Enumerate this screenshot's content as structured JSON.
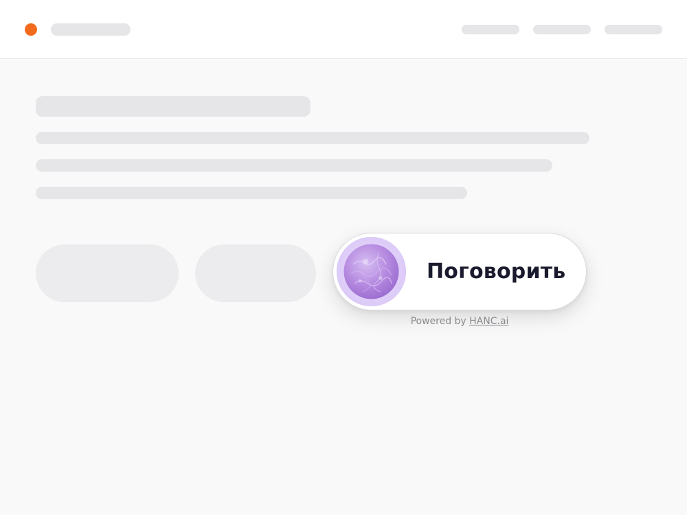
{
  "colors": {
    "brand_dot": "#f26b1d",
    "orb_purple": "#b68be0"
  },
  "widget": {
    "label": "Поговорить",
    "orb_icon": "sphere-orb-icon",
    "powered_prefix": "Powered by ",
    "powered_link": "HANC.ai"
  }
}
